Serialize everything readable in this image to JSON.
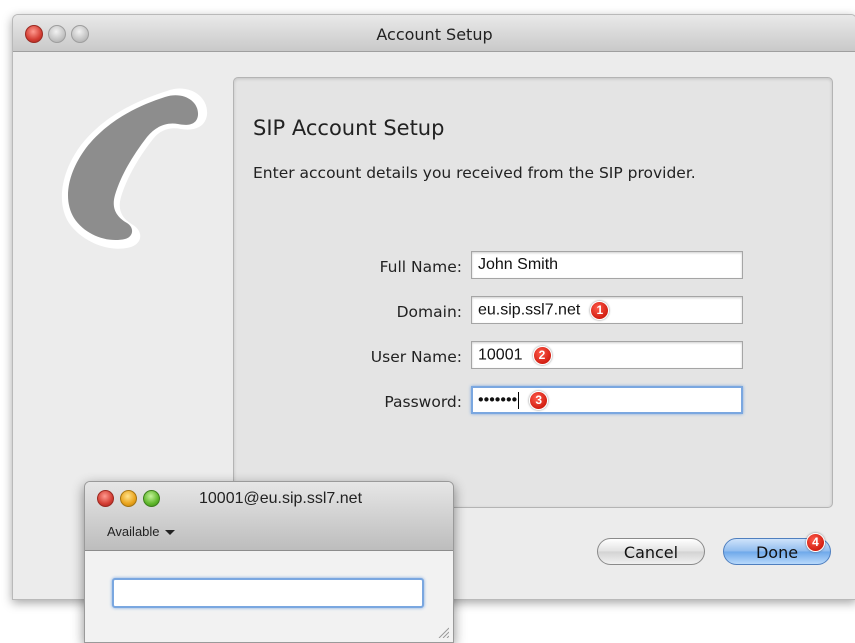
{
  "window": {
    "title": "Account Setup"
  },
  "panel": {
    "title": "SIP Account Setup",
    "description": "Enter account details you received from the SIP provider."
  },
  "form": {
    "full_name": {
      "label": "Full Name:",
      "value": "John Smith"
    },
    "domain": {
      "label": "Domain:",
      "value": "eu.sip.ssl7.net",
      "badge": "1"
    },
    "user_name": {
      "label": "User Name:",
      "value": "10001",
      "badge": "2"
    },
    "password": {
      "label": "Password:",
      "value": "•••••••",
      "badge": "3"
    }
  },
  "buttons": {
    "cancel": "Cancel",
    "done": "Done",
    "done_badge": "4"
  },
  "status_window": {
    "title": "10001@eu.sip.ssl7.net",
    "status": "Available"
  },
  "colors": {
    "badge": "#d21f12",
    "focus": "#7aa7e0",
    "done_button": "#8fbbee"
  },
  "icons": [
    "phone-logo-icon",
    "close-icon",
    "minimize-icon",
    "zoom-icon",
    "chevron-down-icon",
    "resize-grip-icon"
  ]
}
